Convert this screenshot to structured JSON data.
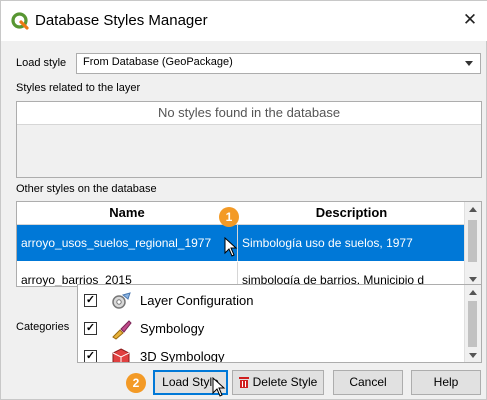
{
  "window": {
    "title": "Database Styles Manager"
  },
  "load_style": {
    "label": "Load style",
    "value": "From Database (GeoPackage)"
  },
  "related": {
    "label": "Styles related to the layer",
    "empty_text": "No styles found in the database"
  },
  "other": {
    "label": "Other styles on the database",
    "columns": [
      "Name",
      "Description"
    ],
    "rows": [
      {
        "name": "arroyo_usos_suelos_regional_1977",
        "description": "Simbología uso de suelos, 1977"
      },
      {
        "name": "arroyo_barrios_2015",
        "description": "simbología de barrios. Municipio d"
      }
    ]
  },
  "categories": {
    "label": "Categories",
    "items": [
      {
        "label": "Layer Configuration",
        "checked": true,
        "icon": "layer-config-icon"
      },
      {
        "label": "Symbology",
        "checked": true,
        "icon": "symbology-icon"
      },
      {
        "label": "3D Symbology",
        "checked": true,
        "icon": "3d-symbology-icon"
      }
    ]
  },
  "buttons": {
    "load": "Load Style",
    "delete": "Delete Style",
    "cancel": "Cancel",
    "help": "Help"
  },
  "callouts": {
    "one": "1",
    "two": "2"
  },
  "colors": {
    "selection": "#0078d7",
    "callout": "#f39a26",
    "qgis_green": "#589632"
  }
}
